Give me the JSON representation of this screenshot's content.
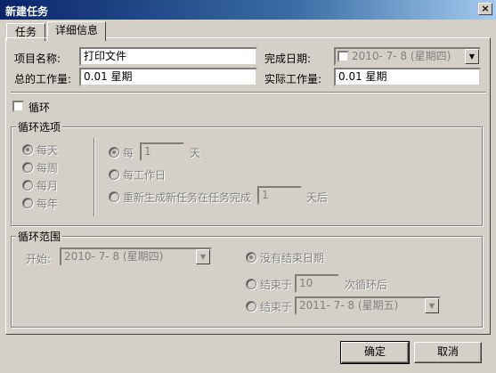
{
  "window": {
    "title": "新建任务",
    "close_glyph": "×"
  },
  "tabs": [
    {
      "label": "任务"
    },
    {
      "label": "详细信息"
    }
  ],
  "form": {
    "name_label": "项目名称:",
    "name_value": "打印文件",
    "finish_date_label": "完成日期:",
    "finish_date_value": "2010- 7- 8 (星期四)",
    "total_work_label": "总的工作量:",
    "total_work_value": "0.01 星期",
    "actual_work_label": "实际工作量:",
    "actual_work_value": "0.01 星期"
  },
  "recur": {
    "checkbox_label": "循环",
    "options_group": {
      "title": "循环选项",
      "freq": [
        "每天",
        "每周",
        "每月",
        "每年"
      ],
      "every_label": "每",
      "every_value": "1",
      "every_unit": "天",
      "every_workday_label": "每工作日",
      "regen_label": "重新生成新任务在任务完成",
      "regen_value": "1",
      "regen_unit": "天后"
    },
    "range_group": {
      "title": "循环范围",
      "start_label": "开始:",
      "start_value": "2010- 7- 8 (星期四)",
      "no_end_label": "没有结束日期",
      "end_after_label": "结束于",
      "end_after_value": "10",
      "end_after_unit": "次循环后",
      "end_by_label": "结束于",
      "end_by_value": "2011- 7- 8 (星期五)"
    }
  },
  "buttons": {
    "ok": "确定",
    "cancel": "取消"
  },
  "icons": {
    "dropdown": "▼"
  },
  "colors": {
    "titlebar_start": "#0a246a",
    "face": "#d4d0c8",
    "disabled_text": "#808080"
  }
}
